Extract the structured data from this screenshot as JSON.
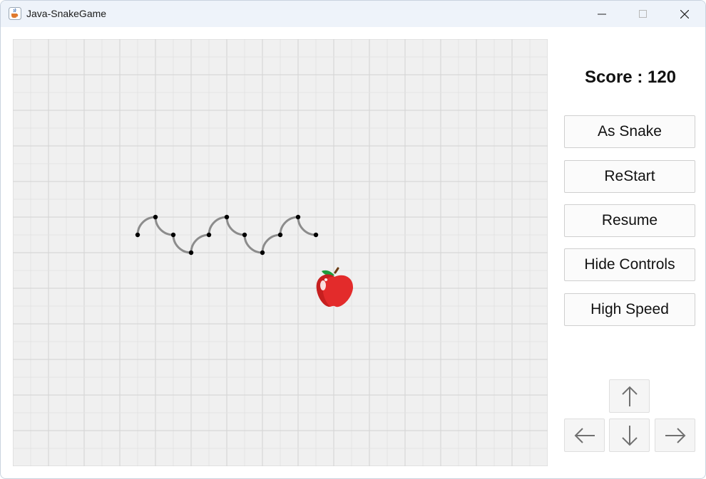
{
  "window": {
    "title": "Java-SnakeGame"
  },
  "score": {
    "label": "Score : 120"
  },
  "controls": {
    "as_snake": "As Snake",
    "restart": "ReStart",
    "resume": "Resume",
    "hide_controls": "Hide Controls",
    "high_speed": "High Speed"
  },
  "arrows": [
    "arrow-up-icon",
    "arrow-left-icon",
    "arrow-down-icon",
    "arrow-right-icon"
  ],
  "icons": {
    "app": "java-cup-icon",
    "minimize": "minimize-icon",
    "maximize": "maximize-icon",
    "close": "close-icon",
    "food": "apple-icon"
  },
  "colors": {
    "board_bg": "#f0f0f0",
    "grid_line": "#d3d3d3",
    "snake_line": "#8c8c8c",
    "snake_joint": "#000000",
    "apple": "#e32b2b"
  }
}
